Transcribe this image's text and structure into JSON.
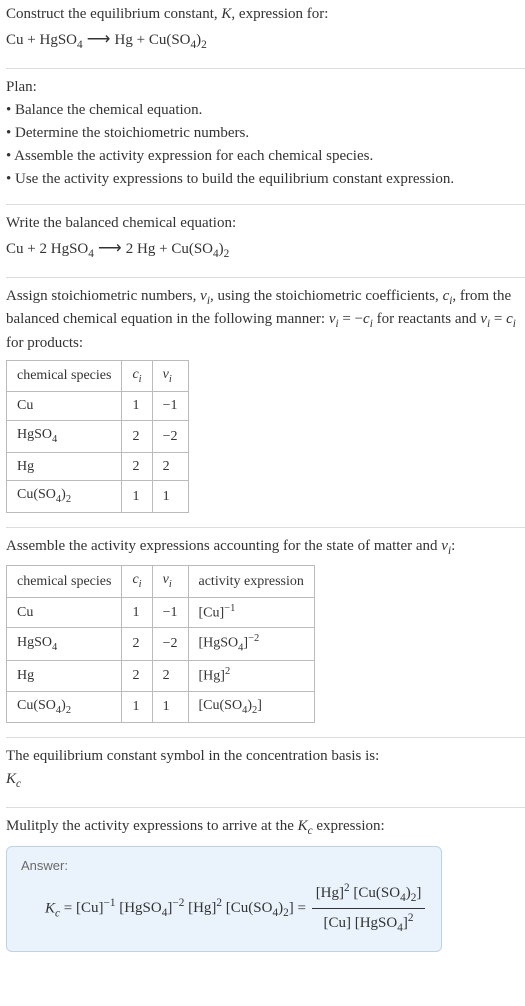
{
  "intro": {
    "line1_a": "Construct the equilibrium constant, ",
    "line1_K": "K",
    "line1_b": ", expression for:"
  },
  "eq_unbalanced": {
    "lhs1": "Cu",
    "plus1": " + ",
    "lhs2": "HgSO",
    "lhs2_sub": "4",
    "arrow": " ⟶ ",
    "rhs1": "Hg",
    "plus2": " + ",
    "rhs2": "Cu(SO",
    "rhs2_sub1": "4",
    "rhs2_mid": ")",
    "rhs2_sub2": "2"
  },
  "plan": {
    "title": "Plan:",
    "b1": "• Balance the chemical equation.",
    "b2": "• Determine the stoichiometric numbers.",
    "b3": "• Assemble the activity expression for each chemical species.",
    "b4": "• Use the activity expressions to build the equilibrium constant expression."
  },
  "balanced_intro": "Write the balanced chemical equation:",
  "eq_balanced": {
    "lhs1": "Cu",
    "plus1": " + ",
    "coef2": "2 ",
    "lhs2": "HgSO",
    "lhs2_sub": "4",
    "arrow": " ⟶ ",
    "coef3": "2 ",
    "rhs1": "Hg",
    "plus2": " + ",
    "rhs2": "Cu(SO",
    "rhs2_sub1": "4",
    "rhs2_mid": ")",
    "rhs2_sub2": "2"
  },
  "assign_intro": {
    "a": "Assign stoichiometric numbers, ",
    "nu": "ν",
    "nu_sub": "i",
    "b": ", using the stoichiometric coefficients, ",
    "c": "c",
    "c_sub": "i",
    "d": ", from the balanced chemical equation in the following manner: ",
    "rel1_lhs_nu": "ν",
    "rel1_lhs_sub": "i",
    "rel1_eq": " = −",
    "rel1_rhs_c": "c",
    "rel1_rhs_sub": "i",
    "e": " for reactants and ",
    "rel2_lhs_nu": "ν",
    "rel2_lhs_sub": "i",
    "rel2_eq": " = ",
    "rel2_rhs_c": "c",
    "rel2_rhs_sub": "i",
    "f": " for products:"
  },
  "table1": {
    "h1": "chemical species",
    "h2_c": "c",
    "h2_sub": "i",
    "h3_nu": "ν",
    "h3_sub": "i",
    "r1": {
      "s": "Cu",
      "c": "1",
      "v": "−1"
    },
    "r2": {
      "s_a": "HgSO",
      "s_sub": "4",
      "c": "2",
      "v": "−2"
    },
    "r3": {
      "s": "Hg",
      "c": "2",
      "v": "2"
    },
    "r4": {
      "s_a": "Cu(SO",
      "s_sub1": "4",
      "s_mid": ")",
      "s_sub2": "2",
      "c": "1",
      "v": "1"
    }
  },
  "activity_intro": {
    "a": "Assemble the activity expressions accounting for the state of matter and ",
    "nu": "ν",
    "nu_sub": "i",
    "b": ":"
  },
  "table2": {
    "h1": "chemical species",
    "h2_c": "c",
    "h2_sub": "i",
    "h3_nu": "ν",
    "h3_sub": "i",
    "h4": "activity expression",
    "r1": {
      "s": "Cu",
      "c": "1",
      "v": "−1",
      "ae_a": "[Cu]",
      "ae_sup": "−1"
    },
    "r2": {
      "s_a": "HgSO",
      "s_sub": "4",
      "c": "2",
      "v": "−2",
      "ae_a": "[HgSO",
      "ae_sub": "4",
      "ae_b": "]",
      "ae_sup": "−2"
    },
    "r3": {
      "s": "Hg",
      "c": "2",
      "v": "2",
      "ae_a": "[Hg]",
      "ae_sup": "2"
    },
    "r4": {
      "s_a": "Cu(SO",
      "s_sub1": "4",
      "s_mid": ")",
      "s_sub2": "2",
      "c": "1",
      "v": "1",
      "ae_a": "[Cu(SO",
      "ae_sub1": "4",
      "ae_mid": ")",
      "ae_sub2": "2",
      "ae_b": "]"
    }
  },
  "symbol_intro": "The equilibrium constant symbol in the concentration basis is:",
  "Kc": {
    "K": "K",
    "sub": "c"
  },
  "multiply_intro": {
    "a": "Mulitply the activity expressions to arrive at the ",
    "K": "K",
    "sub": "c",
    "b": " expression:"
  },
  "answer": {
    "label": "Answer:",
    "K": "K",
    "K_sub": "c",
    "eq1": " = ",
    "t1": "[Cu]",
    "t1_sup": "−1",
    "sp1": " ",
    "t2_a": "[HgSO",
    "t2_sub": "4",
    "t2_b": "]",
    "t2_sup": "−2",
    "sp2": " ",
    "t3": "[Hg]",
    "t3_sup": "2",
    "sp3": " ",
    "t4_a": "[Cu(SO",
    "t4_sub1": "4",
    "t4_mid": ")",
    "t4_sub2": "2",
    "t4_b": "]",
    "eq2": " = ",
    "num_a": "[Hg]",
    "num_a_sup": "2",
    "num_sp": " ",
    "num_b_a": "[Cu(SO",
    "num_b_sub1": "4",
    "num_b_mid": ")",
    "num_b_sub2": "2",
    "num_b_b": "]",
    "den_a": "[Cu]",
    "den_sp": " ",
    "den_b_a": "[HgSO",
    "den_b_sub": "4",
    "den_b_b": "]",
    "den_b_sup": "2"
  },
  "chart_data": {
    "type": "table",
    "tables": [
      {
        "title": "Stoichiometric numbers",
        "columns": [
          "chemical species",
          "c_i",
          "ν_i"
        ],
        "rows": [
          [
            "Cu",
            1,
            -1
          ],
          [
            "HgSO4",
            2,
            -2
          ],
          [
            "Hg",
            2,
            2
          ],
          [
            "Cu(SO4)2",
            1,
            1
          ]
        ]
      },
      {
        "title": "Activity expressions",
        "columns": [
          "chemical species",
          "c_i",
          "ν_i",
          "activity expression"
        ],
        "rows": [
          [
            "Cu",
            1,
            -1,
            "[Cu]^-1"
          ],
          [
            "HgSO4",
            2,
            -2,
            "[HgSO4]^-2"
          ],
          [
            "Hg",
            2,
            2,
            "[Hg]^2"
          ],
          [
            "Cu(SO4)2",
            1,
            1,
            "[Cu(SO4)2]"
          ]
        ]
      }
    ]
  }
}
